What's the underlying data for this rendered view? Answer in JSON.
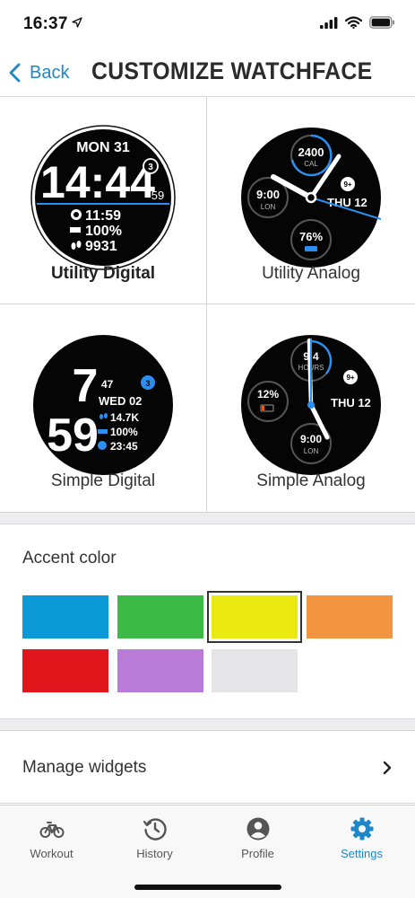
{
  "status": {
    "time": "16:37"
  },
  "nav": {
    "back_label": "Back",
    "title": "CUSTOMIZE WATCHFACE"
  },
  "watchfaces": [
    {
      "label": "Utility Digital",
      "selected": true,
      "date": "MON 31",
      "time": "14:44",
      "seconds": "59",
      "badge": "3",
      "row1": "11:59",
      "row2": "100%",
      "row3": "9931"
    },
    {
      "label": "Utility Analog",
      "selected": false,
      "top_value": "2400",
      "top_unit": "CAL",
      "left_value": "9:00",
      "left_unit": "LON",
      "right_text": "THU 12",
      "badge": "9+",
      "bottom_value": "76%"
    },
    {
      "label": "Simple Digital",
      "selected": false,
      "hour": "7",
      "minute": "59",
      "seconds": "47",
      "badge": "3",
      "date": "WED 02",
      "row1": "14.7K",
      "row2": "100%",
      "row3": "23:45"
    },
    {
      "label": "Simple Analog",
      "selected": false,
      "top_value": "9:4",
      "top_unit": "HOURS",
      "left_value": "12%",
      "right_text": "THU 12",
      "badge": "9+",
      "bottom_value": "9:00",
      "bottom_unit": "LON"
    }
  ],
  "accent": {
    "title": "Accent color",
    "selected_index": 2,
    "swatches": [
      {
        "name": "blue",
        "color": "#0a98d6"
      },
      {
        "name": "green",
        "color": "#3cba46"
      },
      {
        "name": "yellow",
        "color": "#eaea10"
      },
      {
        "name": "orange",
        "color": "#f39440"
      },
      {
        "name": "red",
        "color": "#e1161c"
      },
      {
        "name": "purple",
        "color": "#b97bd8"
      },
      {
        "name": "light-gray",
        "color": "#e5e5e8"
      }
    ]
  },
  "manage": {
    "label": "Manage widgets"
  },
  "tabs": [
    {
      "label": "Workout",
      "icon": "bicycle-icon",
      "active": false
    },
    {
      "label": "History",
      "icon": "clock-history-icon",
      "active": false
    },
    {
      "label": "Profile",
      "icon": "person-icon",
      "active": false
    },
    {
      "label": "Settings",
      "icon": "gear-icon",
      "active": true
    }
  ],
  "colors": {
    "accent_blue": "#1c87c9",
    "face_blue": "#2a8ff0"
  }
}
